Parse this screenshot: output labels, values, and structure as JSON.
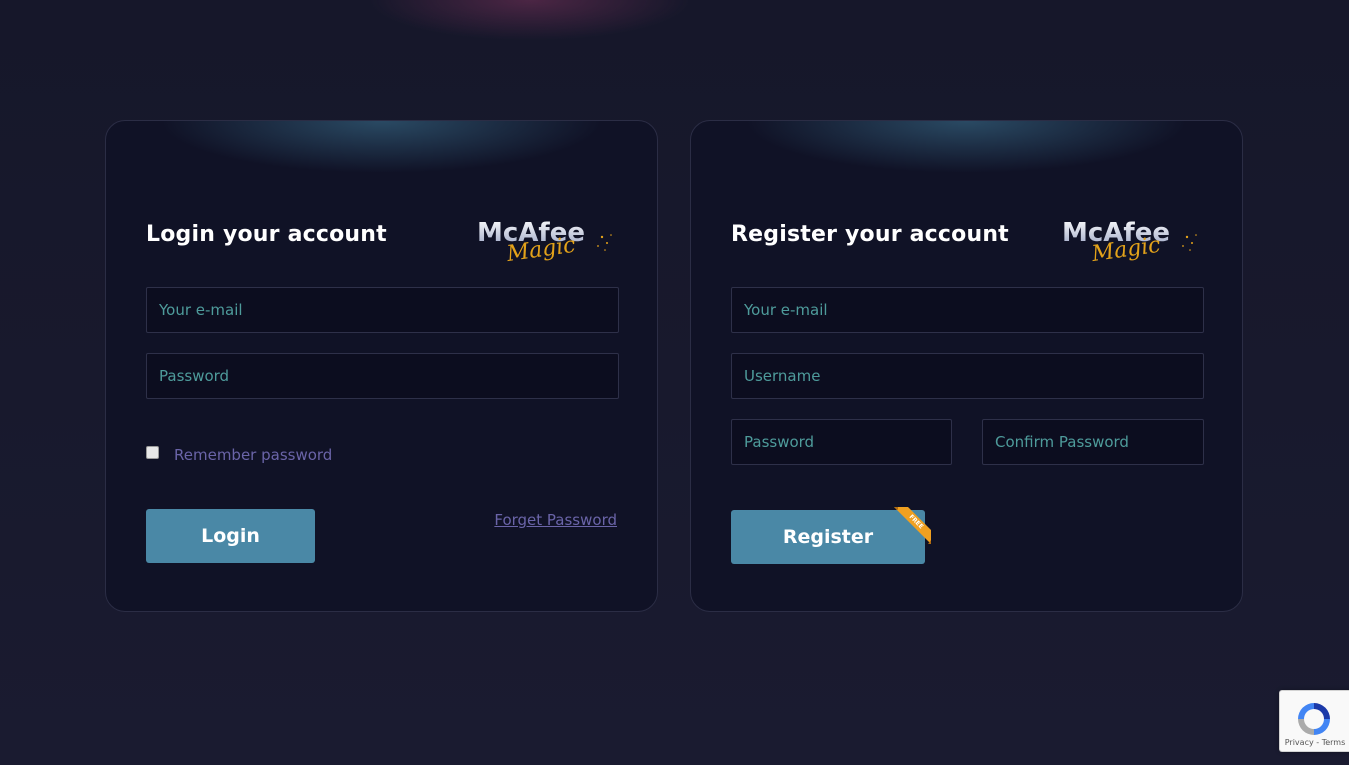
{
  "login": {
    "title": "Login your account",
    "logo_text": "McAfee",
    "logo_script": "Magic",
    "email_placeholder": "Your e-mail",
    "password_placeholder": "Password",
    "remember_label": "Remember password",
    "remember_checked": false,
    "login_button": "Login",
    "forget_link": "Forget Password"
  },
  "register": {
    "title": "Register your account",
    "logo_text": "McAfee",
    "logo_script": "Magic",
    "email_placeholder": "Your e-mail",
    "username_placeholder": "Username",
    "password_placeholder": "Password",
    "confirm_password_placeholder": "Confirm Password",
    "register_button": "Register",
    "ribbon_text": "FREE"
  },
  "recaptcha": {
    "privacy_label": "Privacy",
    "separator": " - ",
    "terms_label": "Terms",
    "icon": "recaptcha-icon"
  },
  "colors": {
    "background": "#191a2e",
    "card": "#101226",
    "button": "#4a88a6",
    "placeholder": "#4e9b9b",
    "link": "#6a64a8",
    "ribbon": "#f0a020"
  }
}
